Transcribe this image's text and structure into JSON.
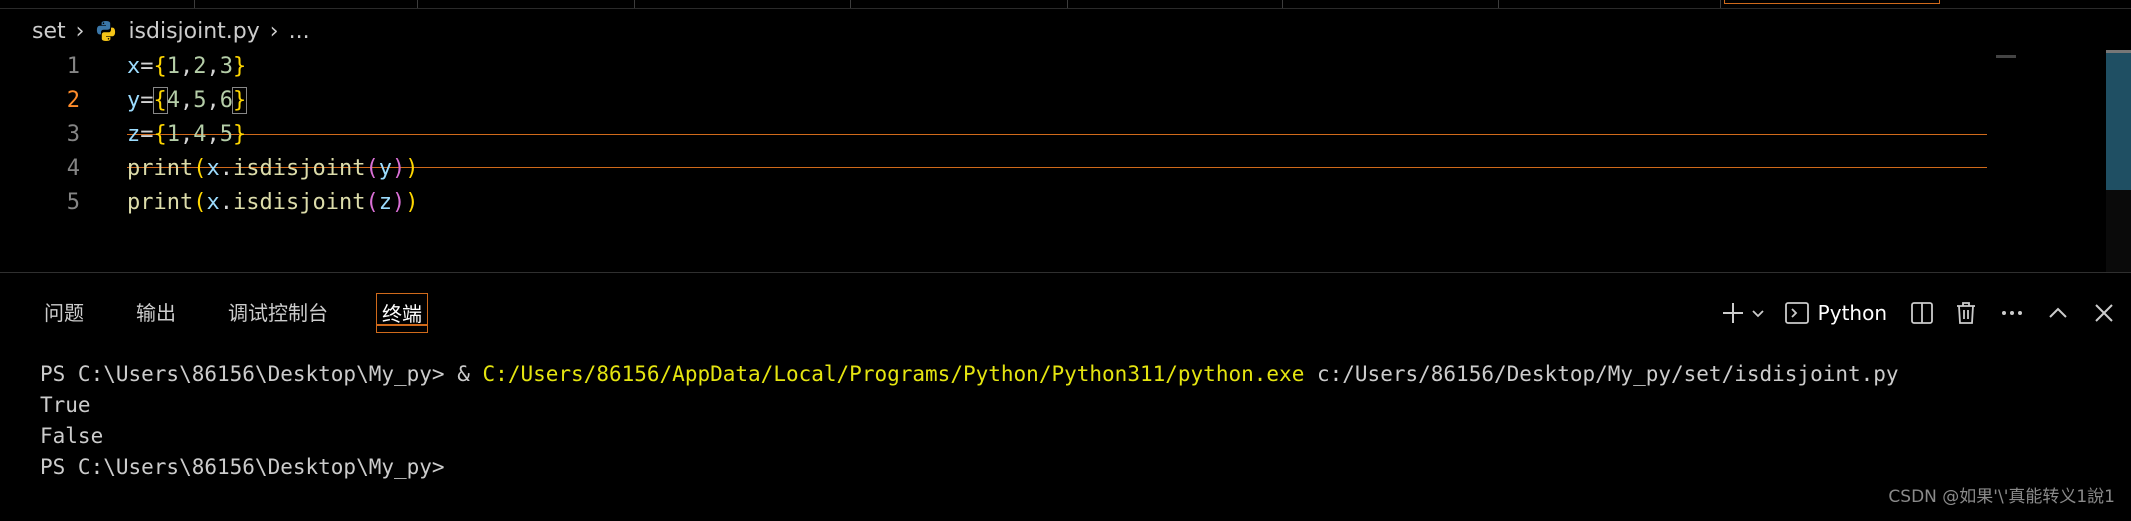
{
  "breadcrumb": {
    "folder": "set",
    "file": "isdisjoint.py",
    "more": "..."
  },
  "editor": {
    "line_numbers": [
      "1",
      "2",
      "3",
      "4",
      "5"
    ],
    "current_line": "2",
    "lines": [
      {
        "var": "x",
        "eq": "=",
        "open": "{",
        "a": "1",
        "c1": ",",
        "b": "2",
        "c2": ",",
        "c": "3",
        "close": "}"
      },
      {
        "var": "y",
        "eq": "=",
        "open": "{",
        "a": "4",
        "c1": ",",
        "b": "5",
        "c2": ",",
        "c": "6",
        "close": "}"
      },
      {
        "var": "z",
        "eq": "=",
        "open": "{",
        "a": "1",
        "c1": ",",
        "b": "4",
        "c2": ",",
        "c": "5",
        "close": "}"
      },
      {
        "fn": "print",
        "p1": "(",
        "obj": "x",
        "dot": ".",
        "method": "isdisjoint",
        "p2": "(",
        "arg": "y",
        "p3": ")",
        "p4": ")"
      },
      {
        "fn": "print",
        "p1": "(",
        "obj": "x",
        "dot": ".",
        "method": "isdisjoint",
        "p2": "(",
        "arg": "z",
        "p3": ")",
        "p4": ")"
      }
    ]
  },
  "panel": {
    "tabs": [
      {
        "label": "问题",
        "active": false
      },
      {
        "label": "输出",
        "active": false
      },
      {
        "label": "调试控制台",
        "active": false
      },
      {
        "label": "终端",
        "active": true
      }
    ],
    "profile_label": "Python",
    "icons": [
      "plus-icon",
      "chevron-down-icon",
      "terminal-icon",
      "split-icon",
      "trash-icon",
      "ellipsis-icon",
      "chevron-up-icon",
      "close-icon"
    ]
  },
  "terminal": {
    "prompt1": "PS C:\\Users\\86156\\Desktop\\My_py> ",
    "amp": "& ",
    "exe_path": "C:/Users/86156/AppData/Local/Programs/Python/Python311/python.exe",
    "script_path": " c:/Users/86156/Desktop/My_py/set/isdisjoint.py",
    "out1": "True",
    "out2": "False",
    "prompt2": "PS C:\\Users\\86156\\Desktop\\My_py>"
  },
  "watermark": "CSDN @如果'\\'真能转义1說1",
  "colors": {
    "accent": "#d06a1b",
    "terminal_path": "#e5e510",
    "background": "#000000"
  }
}
